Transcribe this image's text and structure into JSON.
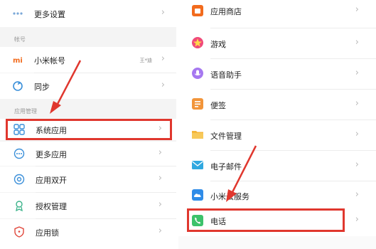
{
  "left": {
    "more_settings": "更多设置",
    "section_account": "帐号",
    "mi_account": "小米帐号",
    "mi_account_value": "王*迪",
    "sync": "同步",
    "section_apps": "应用管理",
    "system_apps": "系统应用",
    "more_apps": "更多应用",
    "dual_apps": "应用双开",
    "permissions": "授权管理",
    "app_lock": "应用锁"
  },
  "right": {
    "app_store": "应用商店",
    "games": "游戏",
    "voice_assistant": "语音助手",
    "notes": "便签",
    "file_manager": "文件管理",
    "email": "电子邮件",
    "mi_cloud": "小米云服务",
    "phone": "电话"
  },
  "icons": {
    "mi": "mi-logo-icon",
    "sync": "sync-icon",
    "system_apps": "system-apps-icon",
    "more_apps": "more-apps-icon",
    "dual_apps": "dual-apps-icon",
    "permissions": "permission-icon",
    "app_lock": "app-lock-icon",
    "app_store": "app-store-icon",
    "games": "games-icon",
    "voice_assistant": "voice-assistant-icon",
    "notes": "notes-icon",
    "file_manager": "folder-icon",
    "email": "email-icon",
    "mi_cloud": "cloud-icon",
    "phone": "phone-icon"
  },
  "chevron": "›",
  "colors": {
    "highlight": "#e0372e",
    "arrow": "#e0372e",
    "mi_orange": "#f26b1d",
    "phone_green": "#3cc26b",
    "cloud_blue": "#2f8ce8",
    "email_blue": "#2fa8e0",
    "notes_orange": "#f2953a",
    "folder_yellow": "#f4b63a",
    "voice_purple": "#a678f0"
  }
}
